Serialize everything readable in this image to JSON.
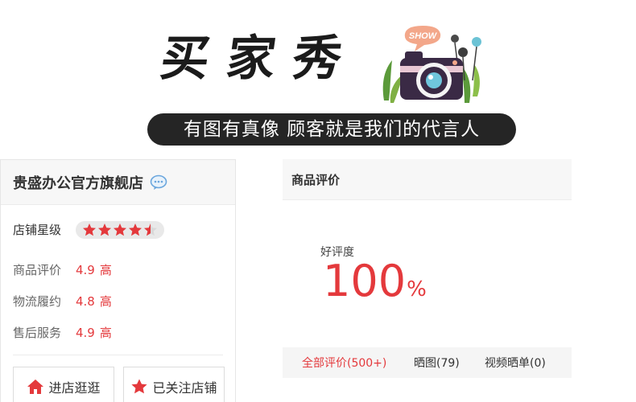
{
  "banner": {
    "title": "买家秀",
    "camera_badge": "SHOW",
    "slogan": "有图有真像 顾客就是我们的代言人"
  },
  "store": {
    "name": "贵盛办公官方旗舰店",
    "rating_label": "店铺星级",
    "stars": 4.5,
    "stars_max": 5,
    "scores": [
      {
        "label": "商品评价",
        "value": "4.9",
        "level": "高"
      },
      {
        "label": "物流履约",
        "value": "4.8",
        "level": "高"
      },
      {
        "label": "售后服务",
        "value": "4.9",
        "level": "高"
      }
    ],
    "buttons": {
      "enter": "进店逛逛",
      "follow": "已关注店铺"
    }
  },
  "reviews": {
    "title": "商品评价",
    "good_rate_label": "好评度",
    "good_rate_value": "100",
    "good_rate_unit": "%",
    "tabs": [
      {
        "label": "全部评价(500+)",
        "active": true
      },
      {
        "label": "晒图(79)",
        "active": false
      },
      {
        "label": "视频晒单(0)",
        "active": false
      }
    ]
  },
  "colors": {
    "accent_red": "#e4393c",
    "header_bg": "#f7f7f7",
    "slogan_bg": "#252525"
  },
  "icons": {
    "chat": "chat-bubble-icon",
    "home": "home-icon",
    "star": "star-icon"
  }
}
